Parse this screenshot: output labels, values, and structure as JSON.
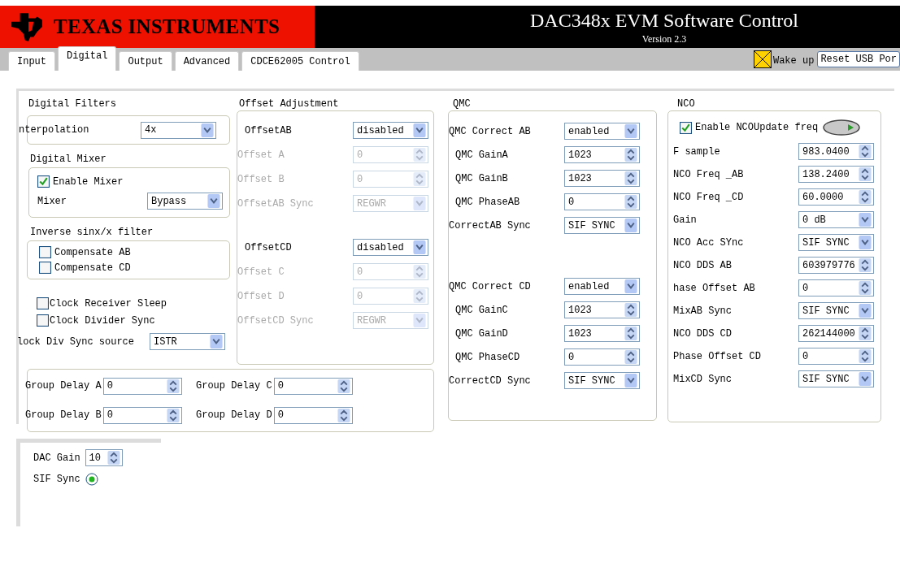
{
  "header": {
    "logo_text": "TEXAS INSTRUMENTS",
    "title": "DAC348x EVM Software Control",
    "version": "Version 2.3"
  },
  "tabs": [
    {
      "label": "Input",
      "selected": false
    },
    {
      "label": "Digital",
      "selected": true
    },
    {
      "label": "Output",
      "selected": false
    },
    {
      "label": "Advanced",
      "selected": false
    },
    {
      "label": "CDCE62005 Control",
      "selected": false
    }
  ],
  "wake_up": {
    "label": "Wake up",
    "on": true
  },
  "reset_button": "Reset USB Por",
  "digital_filters": {
    "title": "Digital Filters",
    "interpolation": {
      "label": "nterpolation",
      "value": "4x"
    },
    "mixer_group": {
      "title": "Digital Mixer",
      "enable": {
        "label": "Enable Mixer",
        "checked": true
      },
      "mixer": {
        "label": "Mixer",
        "value": "Bypass"
      }
    },
    "sinx_group": {
      "title": "Inverse sinx/x filter",
      "items": [
        {
          "label": "Compensate AB",
          "checked": false
        },
        {
          "label": "Compensate CD",
          "checked": false
        }
      ]
    },
    "clock_checks": [
      {
        "label": "Clock Receiver Sleep",
        "checked": false
      },
      {
        "label": "Clock Divider Sync",
        "checked": false
      }
    ],
    "sync_source": {
      "label": "lock Div Sync source",
      "value": "ISTR"
    }
  },
  "offset_adjustment": {
    "title": "Offset Adjustment",
    "groups": [
      [
        {
          "kind": "dropdown",
          "label": "OffsetAB",
          "value": "disabled",
          "disabled": false
        },
        {
          "kind": "numeric",
          "label": "Offset A",
          "value": "0",
          "disabled": true
        },
        {
          "kind": "numeric",
          "label": "Offset B",
          "value": "0",
          "disabled": true
        },
        {
          "kind": "dropdown",
          "label": "OffsetAB Sync",
          "value": "REGWR",
          "disabled": true
        }
      ],
      [
        {
          "kind": "dropdown",
          "label": "OffsetCD",
          "value": "disabled",
          "disabled": false
        },
        {
          "kind": "numeric",
          "label": "Offset C",
          "value": "0",
          "disabled": true
        },
        {
          "kind": "numeric",
          "label": "Offset D",
          "value": "0",
          "disabled": true
        },
        {
          "kind": "dropdown",
          "label": "OffsetCD Sync",
          "value": "REGWR",
          "disabled": true
        }
      ]
    ]
  },
  "group_delay": [
    {
      "label": "Group Delay A",
      "value": "0"
    },
    {
      "label": "Group Delay C",
      "value": "0"
    },
    {
      "label": "Group Delay B",
      "value": "0"
    },
    {
      "label": "Group Delay D",
      "value": "0"
    }
  ],
  "qmc": {
    "title": "QMC",
    "groups": [
      [
        {
          "kind": "dropdown",
          "label": "QMC Correct AB",
          "value": "enabled"
        },
        {
          "kind": "numeric",
          "label": "QMC GainA",
          "value": "1023"
        },
        {
          "kind": "numeric",
          "label": "QMC GainB",
          "value": "1023"
        },
        {
          "kind": "numeric",
          "label": "QMC PhaseAB",
          "value": "0"
        },
        {
          "kind": "dropdown",
          "label": "CorrectAB Sync",
          "value": "SIF SYNC"
        }
      ],
      [
        {
          "kind": "dropdown",
          "label": "QMC Correct CD",
          "value": "enabled"
        },
        {
          "kind": "numeric",
          "label": "QMC GainC",
          "value": "1023"
        },
        {
          "kind": "numeric",
          "label": "QMC GainD",
          "value": "1023"
        },
        {
          "kind": "numeric",
          "label": "QMC PhaseCD",
          "value": "0"
        },
        {
          "kind": "dropdown",
          "label": "CorrectCD Sync",
          "value": "SIF SYNC"
        }
      ]
    ]
  },
  "nco": {
    "title": "NCO",
    "enable": {
      "label": "Enable NCO",
      "checked": true
    },
    "update_label": "Update freq",
    "rows": [
      {
        "kind": "numeric",
        "label": "F sample",
        "value": "983.0400"
      },
      {
        "kind": "numeric",
        "label": "NCO Freq _AB",
        "value": "138.2400"
      },
      {
        "kind": "numeric",
        "label": "NCO Freq _CD",
        "value": "60.0000"
      },
      {
        "kind": "dropdown",
        "label": "Gain",
        "value": "0 dB"
      },
      {
        "kind": "dropdown",
        "label": "NCO Acc SYnc",
        "value": "SIF SYNC"
      },
      {
        "kind": "numeric",
        "label": "NCO DDS AB",
        "value": "603979776"
      },
      {
        "kind": "numeric",
        "label": "hase Offset AB",
        "value": "0"
      },
      {
        "kind": "dropdown",
        "label": "MixAB Sync",
        "value": "SIF SYNC"
      },
      {
        "kind": "numeric",
        "label": "NCO DDS CD",
        "value": "262144000"
      },
      {
        "kind": "numeric",
        "label": "Phase Offset CD",
        "value": "0"
      },
      {
        "kind": "dropdown",
        "label": "MixCD Sync",
        "value": "SIF SYNC"
      }
    ]
  },
  "dac": {
    "gain": {
      "label": "DAC Gain",
      "value": "10"
    },
    "sif_sync": {
      "label": "SIF Sync",
      "selected": true
    }
  }
}
